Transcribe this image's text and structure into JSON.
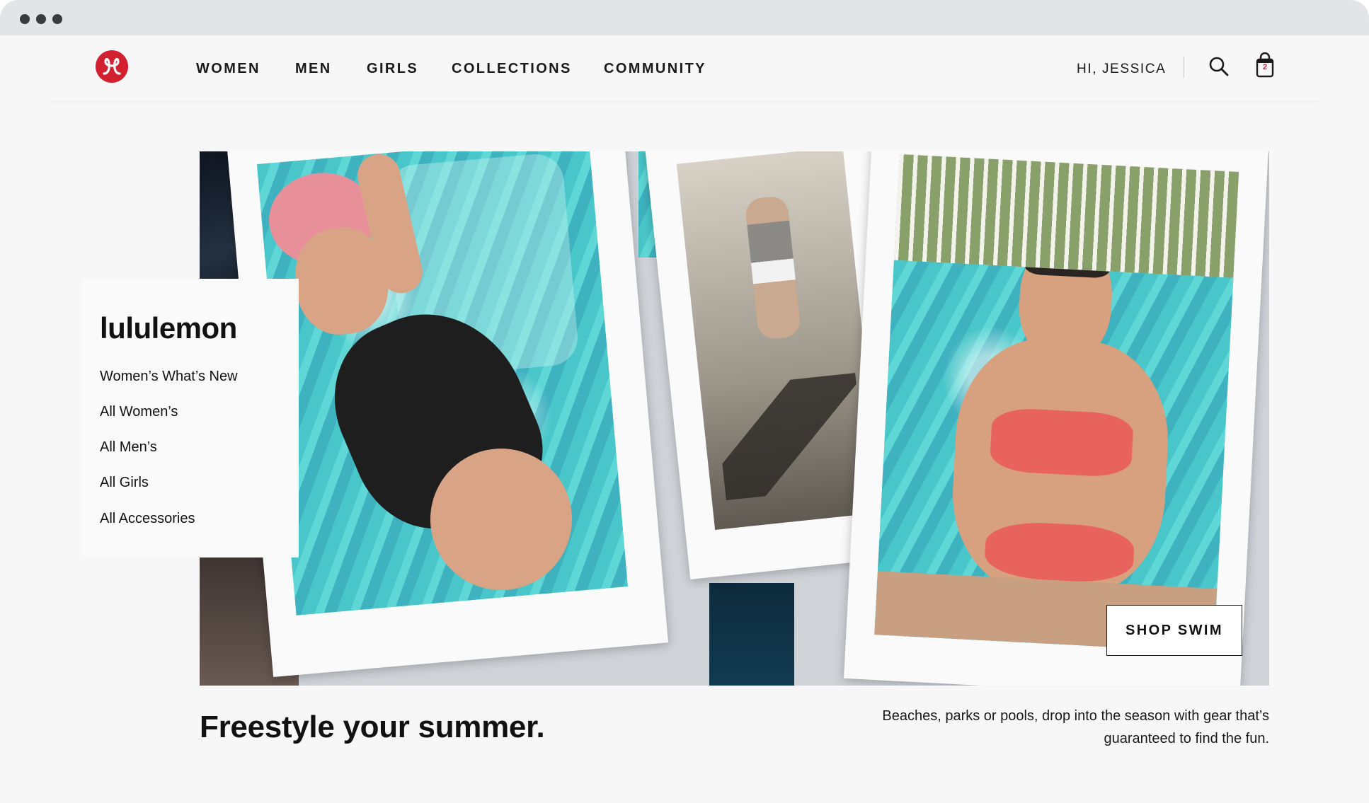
{
  "window": {
    "controls": [
      "close",
      "minimize",
      "maximize"
    ]
  },
  "nav": {
    "logo_icon": "lululemon-logo-icon",
    "items": [
      {
        "label": "WOMEN"
      },
      {
        "label": "MEN"
      },
      {
        "label": "GIRLS"
      },
      {
        "label": "COLLECTIONS"
      },
      {
        "label": "COMMUNITY"
      }
    ],
    "greeting": "HI, JESSICA",
    "search_icon": "search-icon",
    "bag_icon": "shopping-bag-icon",
    "bag_count": "2"
  },
  "sidebar": {
    "title": "lululemon",
    "links": [
      {
        "label": "Women’s What’s New"
      },
      {
        "label": "All Women’s"
      },
      {
        "label": "All Men’s"
      },
      {
        "label": "All Girls"
      },
      {
        "label": "All Accessories"
      }
    ]
  },
  "hero": {
    "cta_label": "SHOP SWIM",
    "headline": "Freestyle your summer.",
    "blurb": "Beaches, parks or pools, drop into the season with gear that’s guaranteed to find the fun."
  },
  "colors": {
    "brand_red": "#d22030",
    "text": "#111111",
    "page_bg": "#f7f7f7"
  }
}
